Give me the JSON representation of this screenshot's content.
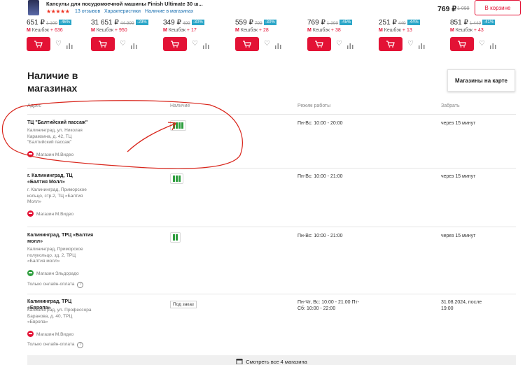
{
  "header": {
    "product_title": "Капсулы для посудомоечной машины Finish Ultimate 30 ш...",
    "stars": "★★★★★",
    "reviews": "13 отзывов",
    "tabs": [
      "Характеристики",
      "Наличие в магазинах"
    ],
    "price": "769 ₽",
    "old_price": "1 099",
    "cart_button": "В корзине"
  },
  "products": [
    {
      "price": "651 ₽",
      "old": "1 199",
      "discount": "-46%",
      "cashback_label": "Кешбэк",
      "cashback": "+ 636"
    },
    {
      "price": "31 651 ₽",
      "old": "44 999",
      "discount": "-29%",
      "cashback_label": "Кешбэк",
      "cashback": "+ 950"
    },
    {
      "price": "349 ₽",
      "old": "499",
      "discount": "-30%",
      "cashback_label": "Кешбэк",
      "cashback": "+ 17"
    },
    {
      "price": "559 ₽",
      "old": "799",
      "discount": "-30%",
      "cashback_label": "Кешбэк",
      "cashback": "+ 28"
    },
    {
      "price": "769 ₽",
      "old": "1 399",
      "discount": "-45%",
      "cashback_label": "Кешбэк",
      "cashback": "+ 38"
    },
    {
      "price": "251 ₽",
      "old": "449",
      "discount": "-44%",
      "cashback_label": "Кешбэк",
      "cashback": "+ 13"
    },
    {
      "price": "851 ₽",
      "old": "1 449",
      "discount": "-41%",
      "cashback_label": "Кешбэк",
      "cashback": "+ 43"
    }
  ],
  "section": {
    "title": "Наличие в магазинах",
    "map_button": "Магазины на карте",
    "columns": {
      "address": "Адрес",
      "availability": "Наличие",
      "hours": "Режим работы",
      "pickup": "Забрать"
    }
  },
  "stores": [
    {
      "name": "ТЦ \"Балтийский пассаж\"",
      "address": "Калининград, ул. Николая Карамзина, д. 42, ТЦ \"Балтийский пассаж\"",
      "shop": "Магазин М.Видео",
      "shop_color": "#e31235",
      "bars": 4,
      "hours": "Пн-Вс: 10:00 - 20:00",
      "pickup": "через 15 минут"
    },
    {
      "name": "г. Калининград, ТЦ «Балтия Молл»",
      "address": "г. Калининград, Приморское кольцо, стр.2, ТЦ «Балтия Молл»",
      "shop": "Магазин М.Видео",
      "shop_color": "#e31235",
      "bars": 3,
      "hours": "Пн-Вс: 10:00 - 21:00",
      "pickup": "через 15 минут"
    },
    {
      "name": "Калининград, ТРЦ «Балтия молл»",
      "address": "Калининград, Приморское полукольцо, зд. 2, ТРЦ «Балтия молл»",
      "shop": "Магазин Эльдорадо",
      "shop_color": "#2e9e3e",
      "bars": 2,
      "online": "Только онлайн-оплата",
      "hours": "Пн-Вс: 10:00 - 21:00",
      "pickup": "через 15 минут"
    },
    {
      "name": "Калининград, ТРЦ «Европа»",
      "address": "Калининград, ул. Профессора Баранова, д. 40, ТРЦ «Европа»",
      "shop": "Магазин М.Видео",
      "shop_color": "#e31235",
      "order_tag": "Под заказ",
      "online": "Только онлайн-оплата",
      "hours": "Пн-Чт, Вс: 10:00 - 21:00 Пт-Сб: 10:00 - 22:00",
      "pickup": "31.08.2024, после 19:00"
    }
  ],
  "all_stores_button": "Смотреть все 4 магазина",
  "annotation_color": "#d9261c"
}
